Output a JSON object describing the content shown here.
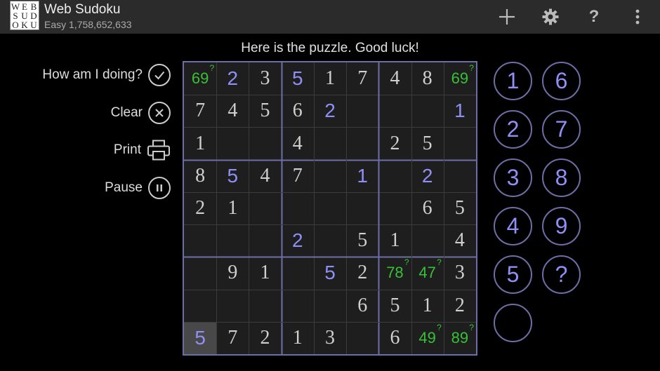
{
  "app": {
    "title": "Web Sudoku",
    "subtitle": "Easy 1,758,652,633",
    "logo_rows": [
      [
        "W",
        "E",
        "B"
      ],
      [
        "S",
        "U",
        "D"
      ],
      [
        "O",
        "K",
        "U"
      ]
    ]
  },
  "toolbar": {
    "icons": [
      "add-icon",
      "settings-gear-icon",
      "help-icon",
      "overflow-menu-icon"
    ]
  },
  "message": "Here is the puzzle. Good luck!",
  "actions": [
    {
      "label": "How am I doing?",
      "icon": "check-circle-icon",
      "name": "how-am-i-doing-button"
    },
    {
      "label": "Clear",
      "icon": "clear-circle-icon",
      "name": "clear-button"
    },
    {
      "label": "Print",
      "icon": "printer-icon",
      "name": "print-button"
    },
    {
      "label": "Pause",
      "icon": "pause-circle-icon",
      "name": "pause-button"
    }
  ],
  "board": {
    "rows": [
      [
        {
          "v": "69",
          "t": "pencil",
          "q": "?"
        },
        {
          "v": "2",
          "t": "user"
        },
        {
          "v": "3",
          "t": "given"
        },
        {
          "v": "5",
          "t": "user"
        },
        {
          "v": "1",
          "t": "given"
        },
        {
          "v": "7",
          "t": "given"
        },
        {
          "v": "4",
          "t": "given"
        },
        {
          "v": "8",
          "t": "given"
        },
        {
          "v": "69",
          "t": "pencil",
          "q": "?"
        }
      ],
      [
        {
          "v": "7",
          "t": "given"
        },
        {
          "v": "4",
          "t": "given"
        },
        {
          "v": "5",
          "t": "given"
        },
        {
          "v": "6",
          "t": "given"
        },
        {
          "v": "2",
          "t": "user"
        },
        {
          "v": "",
          "t": "empty"
        },
        {
          "v": "",
          "t": "empty"
        },
        {
          "v": "",
          "t": "empty"
        },
        {
          "v": "1",
          "t": "user"
        }
      ],
      [
        {
          "v": "1",
          "t": "given"
        },
        {
          "v": "",
          "t": "empty"
        },
        {
          "v": "",
          "t": "empty"
        },
        {
          "v": "4",
          "t": "given"
        },
        {
          "v": "",
          "t": "empty"
        },
        {
          "v": "",
          "t": "empty"
        },
        {
          "v": "2",
          "t": "given"
        },
        {
          "v": "5",
          "t": "given"
        },
        {
          "v": "",
          "t": "empty"
        }
      ],
      [
        {
          "v": "8",
          "t": "given"
        },
        {
          "v": "5",
          "t": "user"
        },
        {
          "v": "4",
          "t": "given"
        },
        {
          "v": "7",
          "t": "given"
        },
        {
          "v": "",
          "t": "empty"
        },
        {
          "v": "1",
          "t": "user"
        },
        {
          "v": "",
          "t": "empty"
        },
        {
          "v": "2",
          "t": "user"
        },
        {
          "v": "",
          "t": "empty"
        }
      ],
      [
        {
          "v": "2",
          "t": "given"
        },
        {
          "v": "1",
          "t": "given"
        },
        {
          "v": "",
          "t": "empty"
        },
        {
          "v": "",
          "t": "empty"
        },
        {
          "v": "",
          "t": "empty"
        },
        {
          "v": "",
          "t": "empty"
        },
        {
          "v": "",
          "t": "empty"
        },
        {
          "v": "6",
          "t": "given"
        },
        {
          "v": "5",
          "t": "given"
        }
      ],
      [
        {
          "v": "",
          "t": "empty"
        },
        {
          "v": "",
          "t": "empty"
        },
        {
          "v": "",
          "t": "empty"
        },
        {
          "v": "2",
          "t": "user"
        },
        {
          "v": "",
          "t": "empty"
        },
        {
          "v": "5",
          "t": "given"
        },
        {
          "v": "1",
          "t": "given"
        },
        {
          "v": "",
          "t": "empty"
        },
        {
          "v": "4",
          "t": "given"
        }
      ],
      [
        {
          "v": "",
          "t": "empty"
        },
        {
          "v": "9",
          "t": "given"
        },
        {
          "v": "1",
          "t": "given"
        },
        {
          "v": "",
          "t": "empty"
        },
        {
          "v": "5",
          "t": "user"
        },
        {
          "v": "2",
          "t": "given"
        },
        {
          "v": "78",
          "t": "pencil",
          "q": "?"
        },
        {
          "v": "47",
          "t": "pencil",
          "q": "?"
        },
        {
          "v": "3",
          "t": "given"
        }
      ],
      [
        {
          "v": "",
          "t": "empty"
        },
        {
          "v": "",
          "t": "empty"
        },
        {
          "v": "",
          "t": "empty"
        },
        {
          "v": "",
          "t": "empty"
        },
        {
          "v": "",
          "t": "empty"
        },
        {
          "v": "6",
          "t": "given"
        },
        {
          "v": "5",
          "t": "given"
        },
        {
          "v": "1",
          "t": "given"
        },
        {
          "v": "2",
          "t": "given"
        }
      ],
      [
        {
          "v": "5",
          "t": "user",
          "sel": true
        },
        {
          "v": "7",
          "t": "given"
        },
        {
          "v": "2",
          "t": "given"
        },
        {
          "v": "1",
          "t": "given"
        },
        {
          "v": "3",
          "t": "given"
        },
        {
          "v": "",
          "t": "empty"
        },
        {
          "v": "6",
          "t": "given"
        },
        {
          "v": "49",
          "t": "pencil",
          "q": "?"
        },
        {
          "v": "89",
          "t": "pencil",
          "q": "?"
        }
      ]
    ]
  },
  "numpad": [
    "1",
    "6",
    "2",
    "7",
    "3",
    "8",
    "4",
    "9",
    "5",
    "?",
    ""
  ],
  "colors": {
    "given": "#cfcfcf",
    "user": "#8f8ff5",
    "pencil": "#38c038",
    "grid_major": "#6e6ea6",
    "grid_minor": "#3c3c3c",
    "selected": "#484848",
    "topbar": "#2b2b2b"
  }
}
